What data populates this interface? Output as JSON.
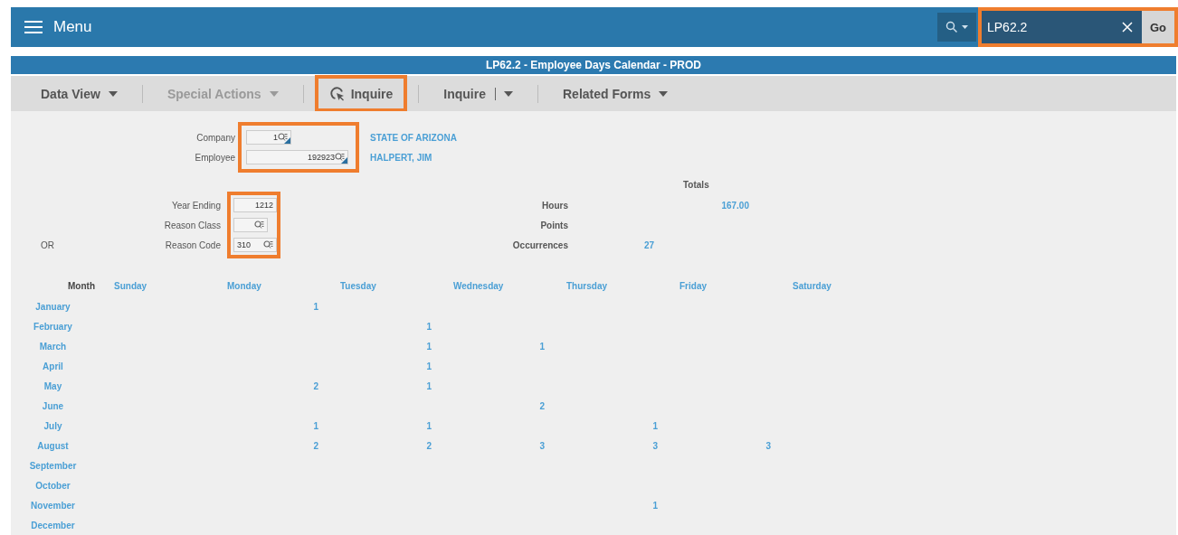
{
  "header": {
    "menu_label": "Menu",
    "search": {
      "value": "LP62.2",
      "go_label": "Go",
      "highlighted": true
    }
  },
  "title": "LP62.2 - Employee Days Calendar - PROD",
  "toolbar": [
    {
      "kind": "menu",
      "label": "Data View",
      "disabled": false,
      "highlighted": false
    },
    {
      "kind": "menu",
      "label": "Special Actions",
      "disabled": true,
      "highlighted": false
    },
    {
      "kind": "action",
      "label": "Inquire",
      "disabled": false,
      "highlighted": true
    },
    {
      "kind": "split",
      "label": "Inquire",
      "disabled": false,
      "highlighted": false
    },
    {
      "kind": "menu",
      "label": "Related Forms",
      "disabled": false,
      "highlighted": false
    }
  ],
  "key_fields": {
    "highlighted": true,
    "fields": [
      {
        "label": "Company",
        "value": "1",
        "lookup": true,
        "description": "STATE OF ARIZONA"
      },
      {
        "label": "Employee",
        "value": "192923",
        "lookup": true,
        "description": "HALPERT, JIM"
      }
    ]
  },
  "totals_title": "Totals",
  "criteria": {
    "highlighted": true,
    "fields": [
      {
        "label": "Year Ending",
        "value": "1212",
        "lookup": false,
        "kind": "number"
      },
      {
        "label": "Reason Class",
        "lookup": true,
        "kind": "code"
      },
      {
        "label": "Reason Code",
        "value": "310",
        "lookup": true,
        "kind": "code",
        "prefix": "OR"
      }
    ]
  },
  "totals": [
    {
      "label": "Hours",
      "value": "167.00",
      "kind": "amount"
    },
    {
      "label": "Points",
      "kind": "amount"
    },
    {
      "label": "Occurrences",
      "value": "27",
      "kind": "count"
    }
  ],
  "calendar": {
    "month_heading": "Month",
    "days": [
      "Sunday",
      "Monday",
      "Tuesday",
      "Wednesday",
      "Thursday",
      "Friday",
      "Saturday"
    ],
    "rows": [
      {
        "month": "January",
        "counts": {
          "monday": "1"
        }
      },
      {
        "month": "February",
        "counts": {
          "tuesday": "1"
        }
      },
      {
        "month": "March",
        "counts": {
          "tuesday": "1",
          "wednesday": "1"
        }
      },
      {
        "month": "April",
        "counts": {
          "tuesday": "1"
        }
      },
      {
        "month": "May",
        "counts": {
          "monday": "2",
          "tuesday": "1"
        }
      },
      {
        "month": "June",
        "counts": {
          "wednesday": "2"
        }
      },
      {
        "month": "July",
        "counts": {
          "monday": "1",
          "tuesday": "1",
          "thursday": "1"
        }
      },
      {
        "month": "August",
        "counts": {
          "monday": "2",
          "tuesday": "2",
          "wednesday": "3",
          "thursday": "3",
          "friday": "3"
        }
      },
      {
        "month": "September"
      },
      {
        "month": "October"
      },
      {
        "month": "November",
        "counts": {
          "thursday": "1"
        }
      },
      {
        "month": "December"
      }
    ]
  }
}
